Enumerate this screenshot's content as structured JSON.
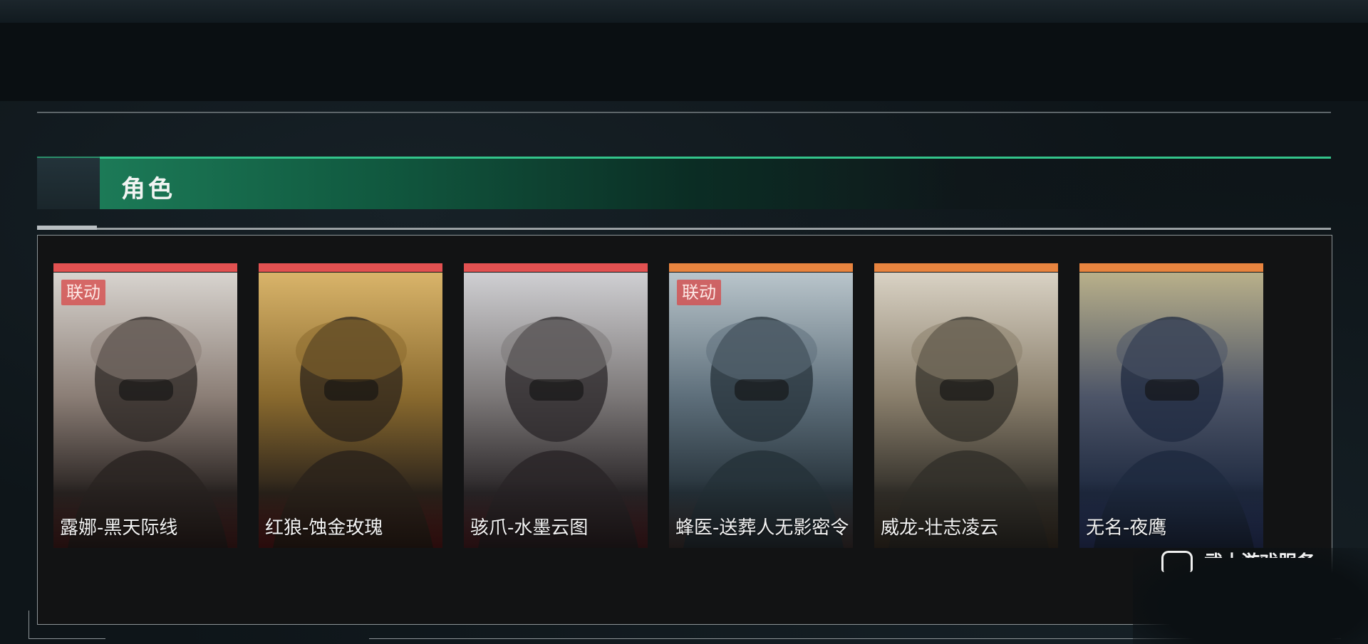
{
  "section": {
    "title": "角色"
  },
  "cards": [
    {
      "name": "露娜-黑天际线",
      "badge": "联动",
      "rarity_color": "#e25151",
      "art_tones": [
        "#d8d4cf",
        "#8b7e76",
        "#2a2422",
        "#4a1f1e"
      ]
    },
    {
      "name": "红狼-蚀金玫瑰",
      "badge": "",
      "rarity_color": "#e25151",
      "art_tones": [
        "#d9b46a",
        "#8a6a2e",
        "#2b231b",
        "#5a1a1a"
      ]
    },
    {
      "name": "骇爪-水墨云图",
      "badge": "",
      "rarity_color": "#e25151",
      "art_tones": [
        "#cfcfd2",
        "#7c7878",
        "#2a2628",
        "#4f1f23"
      ]
    },
    {
      "name": "蜂医-送葬人无影密令",
      "badge": "联动",
      "rarity_color": "#e8843f",
      "art_tones": [
        "#b9c5cb",
        "#5e6f7b",
        "#26323a",
        "#3f3434"
      ]
    },
    {
      "name": "威龙-壮志凌云",
      "badge": "",
      "rarity_color": "#e8843f",
      "art_tones": [
        "#d9d2c4",
        "#8a7f6c",
        "#33302a",
        "#3d3328"
      ]
    },
    {
      "name": "无名-夜鹰",
      "badge": "",
      "rarity_color": "#e8843f",
      "art_tones": [
        "#b9b08a",
        "#4d5568",
        "#1f2a40",
        "#2d3a6b"
      ]
    }
  ],
  "watermark": {
    "text": "武士游戏服务"
  }
}
